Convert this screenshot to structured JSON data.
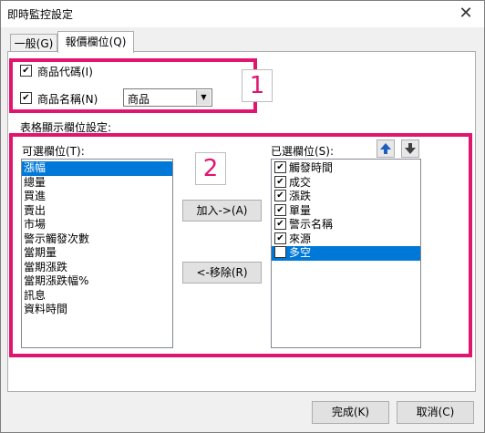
{
  "window": {
    "title": "即時監控設定",
    "close_icon": "close-icon"
  },
  "tabs": [
    {
      "label": "一般(G)"
    },
    {
      "label": "報價欄位(Q)"
    }
  ],
  "options": {
    "product_code": {
      "label": "商品代碼(I)",
      "checked": true
    },
    "product_name": {
      "label": "商品名稱(N)",
      "checked": true
    },
    "name_select": {
      "value": "商品"
    }
  },
  "annotations": {
    "box1": "1",
    "box2": "2",
    "color": "#e0156f"
  },
  "section": {
    "label": "表格顯示欄位設定:"
  },
  "available": {
    "label": "可選欄位(T):",
    "items": [
      "漲幅",
      "總量",
      "買進",
      "賣出",
      "市場",
      "警示觸發次數",
      "當期量",
      "當期漲跌",
      "當期漲跌幅%",
      "訊息",
      "資料時間"
    ],
    "selected_index": 0
  },
  "buttons": {
    "add": "加入->(A)",
    "remove": "<-移除(R)",
    "ok": "完成(K)",
    "cancel": "取消(C)"
  },
  "chosen": {
    "label": "已選欄位(S):",
    "items": [
      "觸發時間",
      "成交",
      "漲跌",
      "單量",
      "警示名稱",
      "來源",
      "多空"
    ],
    "selected_index": 6,
    "move_up_icon": "arrow-up-icon",
    "move_down_icon": "arrow-down-icon"
  },
  "colors": {
    "selection": "#0078d7"
  }
}
